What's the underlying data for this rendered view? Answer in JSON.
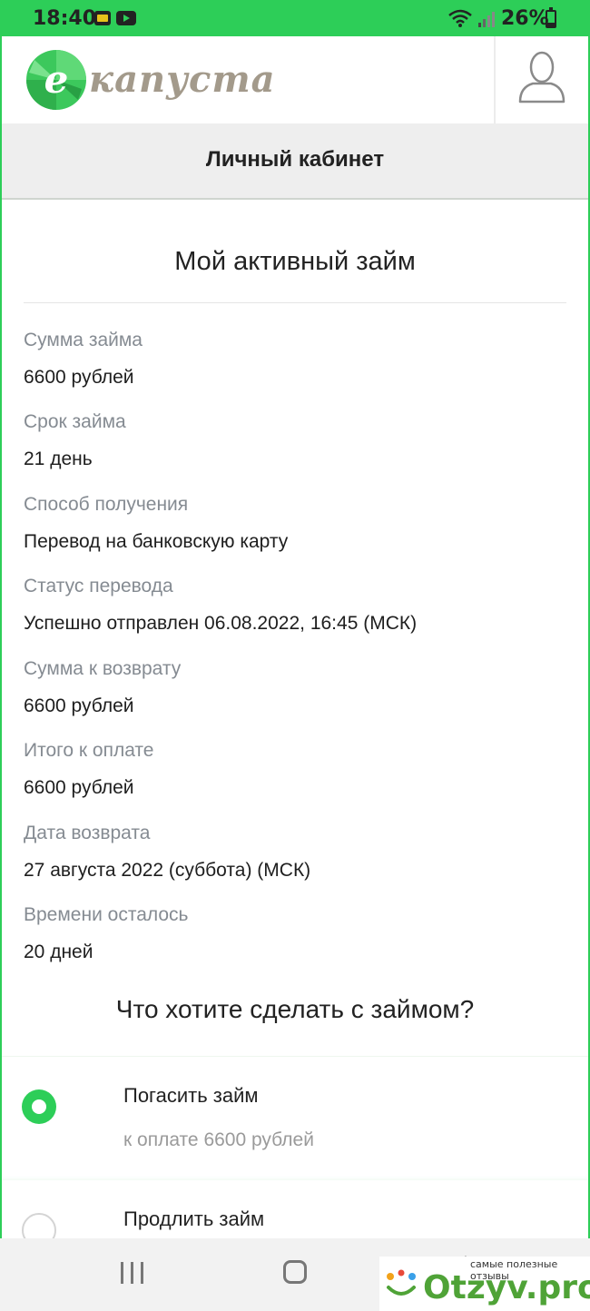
{
  "status_bar": {
    "time": "18:40",
    "battery_percent": "26%",
    "icons": [
      "tv-app-icon",
      "youtube-icon",
      "wifi-icon",
      "signal-icon",
      "battery-icon"
    ]
  },
  "header": {
    "logo_letter": "e",
    "logo_text": "капуста",
    "brand_color": "#2dce58",
    "profile_icon": "user-icon"
  },
  "title_bar": {
    "title": "Личный кабинет"
  },
  "loan": {
    "title": "Мой активный займ",
    "details": [
      {
        "label": "Сумма займа",
        "value": "6600 рублей"
      },
      {
        "label": "Срок займа",
        "value": "21 день"
      },
      {
        "label": "Способ получения",
        "value": "Перевод на банковскую карту"
      },
      {
        "label": "Статус перевода",
        "value": "Успешно отправлен 06.08.2022, 16:45 (МСК)"
      },
      {
        "label": "Сумма к возврату",
        "value": "6600 рублей"
      },
      {
        "label": "Итого к оплате",
        "value": "6600 рублей"
      },
      {
        "label": "Дата возврата",
        "value": "27 августа 2022 (суббота) (МСК)"
      },
      {
        "label": "Времени осталось",
        "value": "20 дней"
      }
    ]
  },
  "actions": {
    "question": "Что хотите сделать с займом?",
    "options": [
      {
        "title": "Погасить займ",
        "subtitle": "к оплате 6600 рублей",
        "selected": true
      },
      {
        "title": "Продлить займ",
        "selected": false
      }
    ]
  },
  "nav_bar": {
    "icons": [
      "recent-apps-icon",
      "home-icon",
      "back-icon"
    ]
  },
  "watermark": {
    "caption": "самые полезные отзывы",
    "text": "Otzyv.pro"
  }
}
